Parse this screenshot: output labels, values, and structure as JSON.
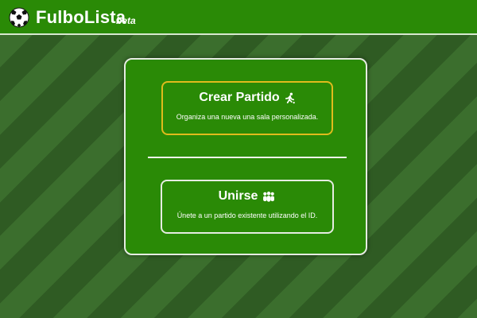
{
  "app": {
    "brand": "FulboLista",
    "badge": "beta"
  },
  "colors": {
    "header_bg": "#2a8a06",
    "panel_bg": "#2a8a06",
    "create_border": "#e0bb1c",
    "background_stripes": [
      "#2f5b23",
      "#3b6e2d"
    ]
  },
  "options": {
    "create": {
      "title": "Crear Partido",
      "icon": "running-person-icon",
      "description": "Organiza una nueva una sala personalizada."
    },
    "join": {
      "title": "Unirse",
      "icon": "group-people-icon",
      "description": "Únete a un partido existente utilizando el ID."
    }
  }
}
